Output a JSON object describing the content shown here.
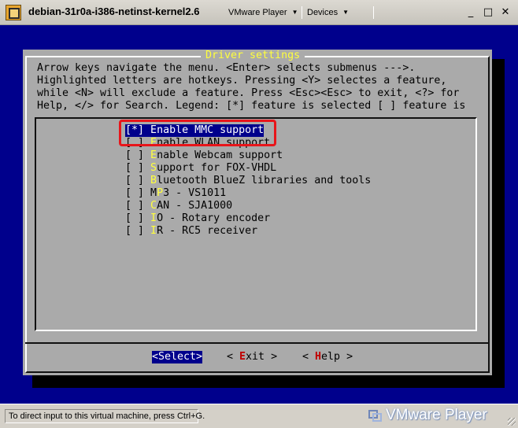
{
  "window": {
    "title": "debian-31r0a-i386-netinst-kernel2.6",
    "menus": [
      {
        "label": "VMware Player"
      },
      {
        "label": "Devices"
      }
    ],
    "controls": {
      "minimize": "_",
      "maximize": "□",
      "close": "✕"
    }
  },
  "dialog": {
    "title": "Driver settings",
    "help_lines": [
      "Arrow keys navigate the menu.  <Enter> selects submenus --->.",
      "Highlighted letters are hotkeys.  Pressing <Y> selectes a feature,",
      "while <N> will exclude a feature.  Press <Esc><Esc> to exit, <?> for",
      "Help, </> for Search.  Legend: [*] feature is selected  [ ] feature is"
    ],
    "items": [
      {
        "state": "[*]",
        "hotkey": "E",
        "rest": "nable MMC support",
        "selected": true
      },
      {
        "state": "[ ]",
        "hotkey": "E",
        "rest": "nable WLAN support",
        "selected": false
      },
      {
        "state": "[ ]",
        "hotkey": "E",
        "rest": "nable Webcam support",
        "selected": false
      },
      {
        "state": "[ ]",
        "hotkey": "S",
        "rest": "upport for FOX-VHDL",
        "selected": false
      },
      {
        "state": "[ ]",
        "hotkey": "B",
        "rest": "luetooth BlueZ libraries and tools",
        "selected": false
      },
      {
        "state": "[ ]",
        "prefix": "M",
        "hotkey": "P",
        "rest": "3 - VS1011",
        "selected": false
      },
      {
        "state": "[ ]",
        "hotkey": "C",
        "rest": "AN - SJA1000",
        "selected": false
      },
      {
        "state": "[ ]",
        "hotkey": "I",
        "rest": "O - Rotary encoder",
        "selected": false
      },
      {
        "state": "[ ]",
        "hotkey": "I",
        "rest": "R - RC5 receiver",
        "selected": false
      }
    ],
    "buttons": {
      "select": {
        "label": "<Select>"
      },
      "exit": {
        "open": "< ",
        "hotkey": "E",
        "rest": "xit",
        "close": " >"
      },
      "help": {
        "open": "< ",
        "hotkey": "H",
        "rest": "elp",
        "close": " >"
      }
    }
  },
  "statusbar": {
    "hint": "To direct input to this virtual machine, press Ctrl+G.",
    "brand": "VMware Player"
  },
  "colors": {
    "screen_bg": "#00008c",
    "dialog_bg": "#aaaaaa",
    "hotkey": "#ffff3c",
    "highlight": "#e8151a"
  }
}
